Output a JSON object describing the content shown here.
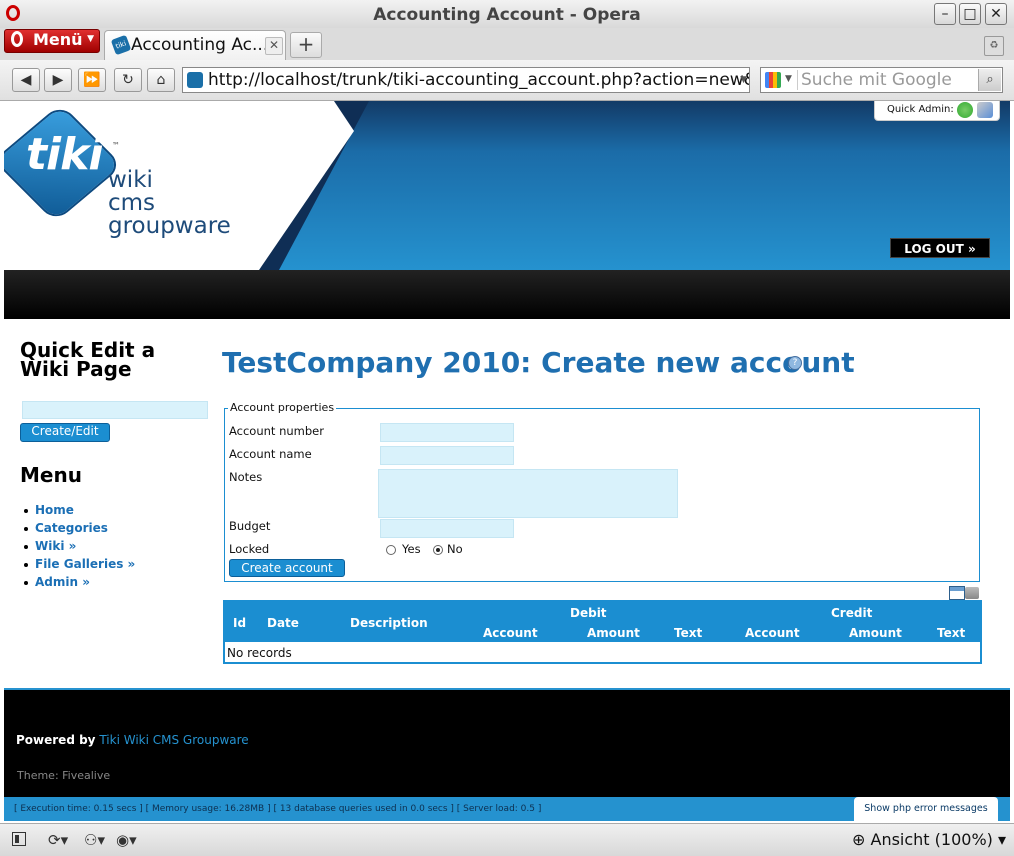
{
  "window": {
    "title": "Accounting Account - Opera"
  },
  "browser": {
    "menu_label": "Menü",
    "tab_title": "Accounting Ac...",
    "url": "http://localhost/trunk/tiki-accounting_account.php?action=new&boo",
    "search_placeholder": "Suche mit Google",
    "zoom_label": "Ansicht (100%)"
  },
  "header": {
    "logo_word": "tiki",
    "logo_tm": "™",
    "logo_line1": "wiki",
    "logo_line2": "cms",
    "logo_line3": "groupware",
    "quick_admin_label": "Quick Admin:",
    "logout_label": "LOG OUT »"
  },
  "sidebar": {
    "quick_edit_title": "Quick Edit a Wiki Page",
    "quick_edit_value": "",
    "quick_edit_button": "Create/Edit",
    "menu_title": "Menu",
    "menu_items": [
      {
        "label": "Home"
      },
      {
        "label": "Categories"
      },
      {
        "label": "Wiki »"
      },
      {
        "label": "File Galleries »"
      },
      {
        "label": "Admin »"
      }
    ]
  },
  "main": {
    "page_title": "TestCompany 2010: Create new account",
    "form": {
      "legend": "Account properties",
      "account_number_label": "Account number",
      "account_number_value": "",
      "account_name_label": "Account name",
      "account_name_value": "",
      "notes_label": "Notes",
      "notes_value": "",
      "budget_label": "Budget",
      "budget_value": "",
      "locked_label": "Locked",
      "locked_yes": "Yes",
      "locked_no": "No",
      "locked_selected": "No",
      "submit_label": "Create account"
    },
    "table": {
      "headers": {
        "id": "Id",
        "date": "Date",
        "description": "Description",
        "debit": "Debit",
        "credit": "Credit",
        "account": "Account",
        "amount": "Amount",
        "text": "Text"
      },
      "empty_message": "No records"
    }
  },
  "footer": {
    "powered_by": "Powered by",
    "powered_link": "Tiki Wiki CMS Groupware",
    "theme": "Theme: Fivealive",
    "status": "[ Execution time: 0.15 secs ]   [ Memory usage: 16.28MB ]   [ 13 database queries used in 0.0 secs ]   [ Server load: 0.5 ]",
    "php_errors_button": "Show php error messages"
  },
  "colors": {
    "accent": "#1b8ed1",
    "title_blue": "#1f6fb0",
    "input_bg": "#d9f2fb",
    "footer_bg": "#000000"
  }
}
